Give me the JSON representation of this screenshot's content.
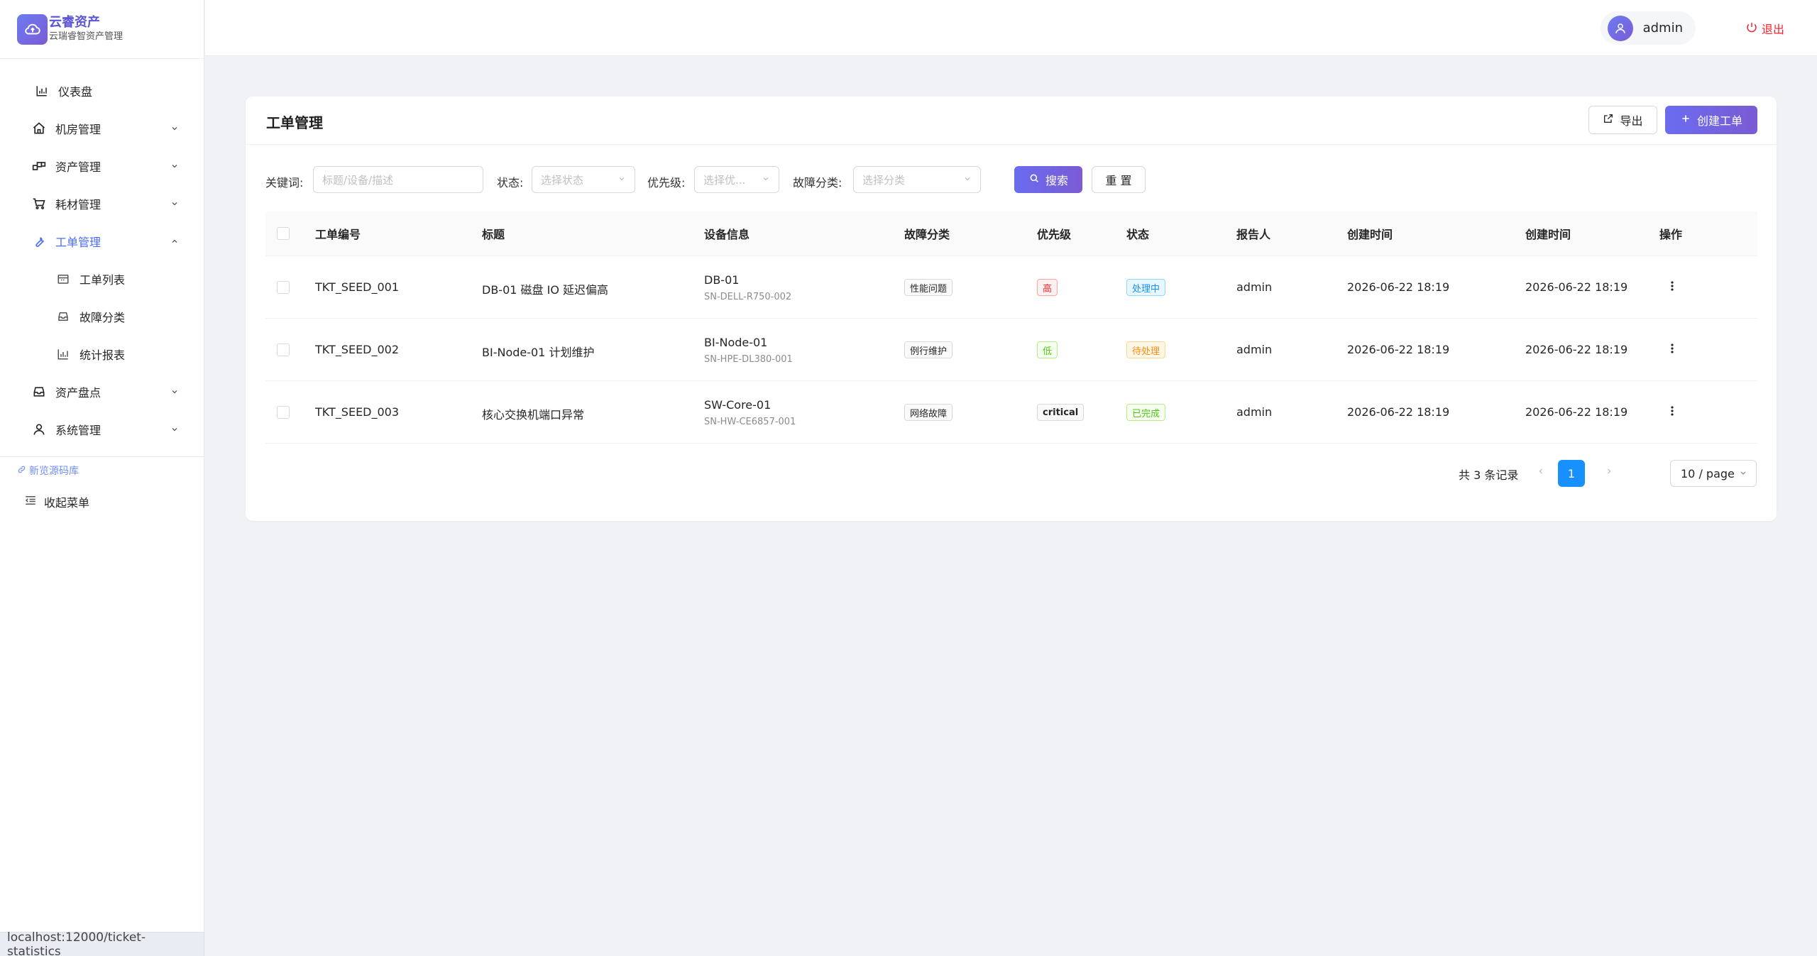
{
  "brand": {
    "title": "云睿资产",
    "subtitle": "云瑞睿智资产管理"
  },
  "sidebar": {
    "items": [
      {
        "label": "仪表盘",
        "icon": "bar-chart-icon"
      },
      {
        "label": "机房管理",
        "icon": "home-icon"
      },
      {
        "label": "资产管理",
        "icon": "cluster-icon"
      },
      {
        "label": "耗材管理",
        "icon": "cart-icon"
      },
      {
        "label": "工单管理",
        "icon": "wrench-icon",
        "active": true
      },
      {
        "label": "资产盘点",
        "icon": "inbox-icon"
      },
      {
        "label": "系统管理",
        "icon": "user-icon"
      }
    ],
    "submenu": [
      {
        "label": "工单列表",
        "icon": "calendar-icon"
      },
      {
        "label": "故障分类",
        "icon": "inbox-icon"
      },
      {
        "label": "统计报表",
        "icon": "bar-chart-icon"
      }
    ],
    "source_link": "新览源码库",
    "collapse": "收起菜单",
    "status_url": "localhost:12000/ticket-statistics"
  },
  "header": {
    "user": "admin",
    "logout": "退出"
  },
  "card": {
    "title": "工单管理",
    "export_label": "导出",
    "create_label": "创建工单"
  },
  "filters": {
    "keyword_label": "关键词:",
    "keyword_placeholder": "标题/设备/描述",
    "status_label": "状态:",
    "status_placeholder": "选择状态",
    "priority_label": "优先级:",
    "priority_placeholder": "选择优...",
    "category_label": "故障分类:",
    "category_placeholder": "选择分类",
    "search_label": "搜索",
    "reset_label": "重 置"
  },
  "table": {
    "columns": [
      "工单编号",
      "标题",
      "设备信息",
      "故障分类",
      "优先级",
      "状态",
      "报告人",
      "创建时间",
      "创建时间",
      "操作"
    ],
    "rows": [
      {
        "id": "TKT_SEED_001",
        "title": "DB-01 磁盘 IO 延迟偏高",
        "device": "DB-01",
        "sn": "SN-DELL-R750-002",
        "category": "性能问题",
        "priority": "高",
        "status": "处理中",
        "reporter": "admin",
        "created": "2026-06-22 18:19",
        "created2": "2026-06-22 18:19"
      },
      {
        "id": "TKT_SEED_002",
        "title": "BI-Node-01 计划维护",
        "device": "BI-Node-01",
        "sn": "SN-HPE-DL380-001",
        "category": "例行维护",
        "priority": "低",
        "status": "待处理",
        "reporter": "admin",
        "created": "2026-06-22 18:19",
        "created2": "2026-06-22 18:19"
      },
      {
        "id": "TKT_SEED_003",
        "title": "核心交换机端口异常",
        "device": "SW-Core-01",
        "sn": "SN-HW-CE6857-001",
        "category": "网络故障",
        "priority": "critical",
        "status": "已完成",
        "reporter": "admin",
        "created": "2026-06-22 18:19",
        "created2": "2026-06-22 18:19"
      }
    ]
  },
  "pagination": {
    "total": "共 3 条记录",
    "current": "1",
    "page_size": "10 / page"
  },
  "colors": {
    "accent": "#6a6cf0",
    "priority_high": "#f5222d",
    "priority_low": "#52c41a",
    "status_processing": "#1890ff",
    "status_pending": "#fa8c16",
    "status_done": "#52c41a"
  }
}
